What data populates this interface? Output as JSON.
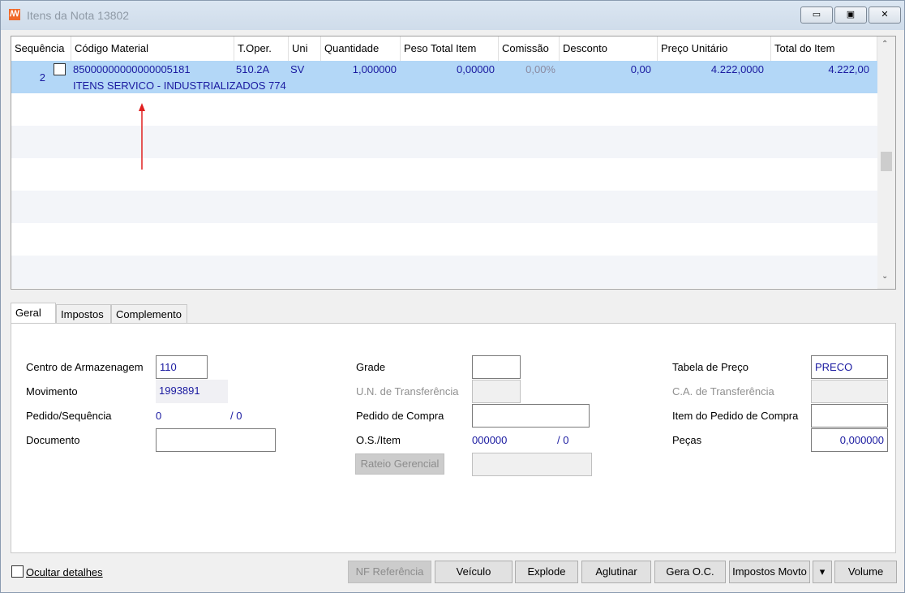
{
  "window": {
    "title": "Itens da Nota 13802",
    "minimize": "▭",
    "maximize": "▣",
    "close": "✕"
  },
  "grid": {
    "columns": [
      "Sequência",
      "Código Material",
      "T.Oper.",
      "Uni",
      "Quantidade",
      "Peso Total Item",
      "Comissão",
      "Desconto",
      "Preço Unitário",
      "Total do Item"
    ],
    "rows": [
      {
        "sequencia": "2",
        "codigo": "85000000000000005181",
        "descricao": "ITENS SERVICO - INDUSTRIALIZADOS 774",
        "toper": "510.2A",
        "uni": "SV",
        "quantidade": "1,000000",
        "peso": "0,00000",
        "comissao": "0,00%",
        "desconto": "0,00",
        "preco": "4.222,0000",
        "total": "4.222,00"
      }
    ]
  },
  "tabs": [
    "Geral",
    "Impostos",
    "Complemento"
  ],
  "geral": {
    "centro_label": "Centro de Armazenagem",
    "centro_value": "110",
    "movimento_label": "Movimento",
    "movimento_value": "1993891",
    "pedido_seq_label": "Pedido/Sequência",
    "pedido_value": "0",
    "seq_value": "/ 0",
    "documento_label": "Documento",
    "documento_value": "",
    "grade_label": "Grade",
    "grade_value": "",
    "un_transf_label": "U.N. de Transferência",
    "pedido_compra_label": "Pedido de Compra",
    "pedido_compra_value": "",
    "os_item_label": "O.S./Item",
    "os_value": "000000",
    "item_value": "/ 0",
    "rateio_button": "Rateio Gerencial",
    "tabela_label": "Tabela de Preço",
    "tabela_value": "PRECO",
    "ca_transf_label": "C.A. de Transferência",
    "item_pedido_label": "Item do Pedido de Compra",
    "item_pedido_value": "",
    "pecas_label": "Peças",
    "pecas_value": "0,000000"
  },
  "footer": {
    "ocultar_label": "Ocultar detalhes",
    "buttons": [
      "NF Referência",
      "Veículo",
      "Explode",
      "Aglutinar",
      "Gera O.C.",
      "Impostos Movto",
      "▾",
      "Volume"
    ]
  },
  "annotation_color": "#e02020"
}
